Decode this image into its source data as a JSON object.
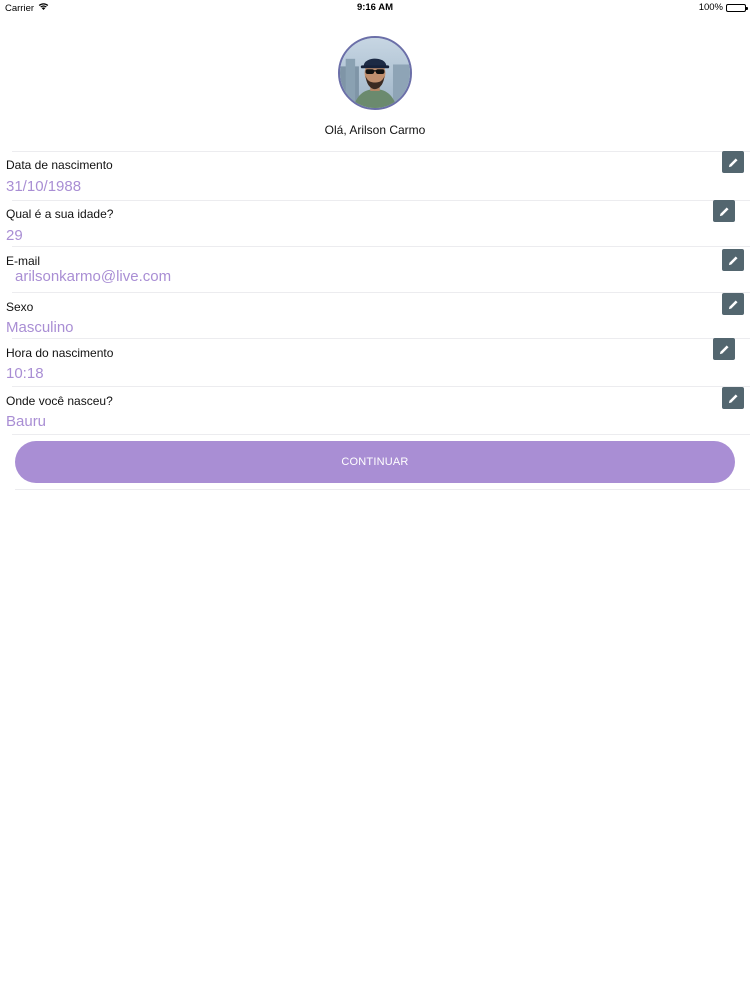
{
  "status_bar": {
    "carrier": "Carrier",
    "time": "9:16 AM",
    "battery": "100%"
  },
  "profile": {
    "greeting": "Olá, Arilson Carmo"
  },
  "fields": {
    "birth_date": {
      "label": "Data de nascimento",
      "value": "31/10/1988"
    },
    "age": {
      "label": "Qual é a sua idade?",
      "value": "29"
    },
    "email": {
      "label": "E-mail",
      "value": "arilsonkarmo@live.com"
    },
    "sex": {
      "label": "Sexo",
      "value": "Masculino"
    },
    "birth_time": {
      "label": "Hora do nascimento",
      "value": "10:18"
    },
    "birth_place": {
      "label": "Onde você nasceu?",
      "value": "Bauru"
    }
  },
  "actions": {
    "continue_label": "CONTINUAR"
  },
  "colors": {
    "accent": "#a98ed4",
    "edit_button": "#53666f",
    "divider": "#ececef"
  },
  "icons": {
    "edit": "pencil-icon",
    "wifi": "wifi-icon",
    "battery": "battery-icon"
  }
}
